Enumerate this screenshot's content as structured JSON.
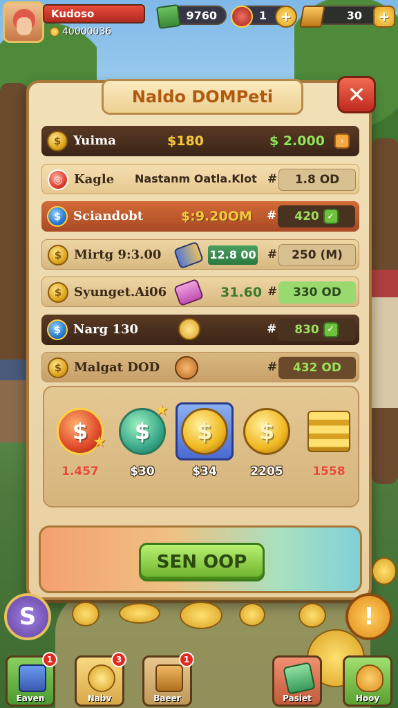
{
  "hud": {
    "player_name": "Kudoso",
    "player_score": "40000036",
    "cash": "9760",
    "gems": "1",
    "gold": "30",
    "plus_label": "+"
  },
  "panel": {
    "title": "Naldo DOMPeti",
    "close_label": "✕"
  },
  "rows": [
    {
      "name": "Yuima",
      "amount": "$180",
      "price": "$ 2.000",
      "hash": ""
    },
    {
      "name": "Kagle",
      "amount": "Nastanm Oatla.Klot",
      "price": "1.8 OD",
      "hash": "#"
    },
    {
      "name": "Sciandobt",
      "amount": "$:9.20OM",
      "price": "420",
      "hash": "#"
    },
    {
      "name": "Mirtg 9:3.00",
      "amount": "12.8 00",
      "price": "250 (M)",
      "hash": "#"
    },
    {
      "name": "Syunget.Ai06",
      "amount": "31.60",
      "price": "330 OD",
      "hash": "#"
    },
    {
      "name": "Narg 130",
      "amount": "",
      "price": "830",
      "hash": "#"
    },
    {
      "name": "Malgat DOD",
      "amount": "",
      "price": "432 OD",
      "hash": "#"
    }
  ],
  "shop": {
    "items": [
      {
        "price": "1.457",
        "symbol": "$"
      },
      {
        "price": "$30",
        "symbol": "$"
      },
      {
        "price": "$34",
        "symbol": "$"
      },
      {
        "price": "2205",
        "symbol": "$"
      },
      {
        "price": "1558",
        "symbol": ""
      }
    ]
  },
  "action_button": "SEN OOP",
  "side": {
    "left_label": "S",
    "right_label": "!"
  },
  "dock": {
    "items": [
      {
        "label": "Eaven",
        "badge": "1"
      },
      {
        "label": "Nabv",
        "badge": "3"
      },
      {
        "label": "Baeer",
        "badge": "1"
      },
      {
        "label": "Pasiet",
        "badge": ""
      },
      {
        "label": "Hooy",
        "badge": ""
      }
    ]
  },
  "colors": {
    "accent_red": "#e84a3a",
    "gold": "#f8c840",
    "green": "#6ab02a",
    "panel": "#f2e0b8"
  }
}
